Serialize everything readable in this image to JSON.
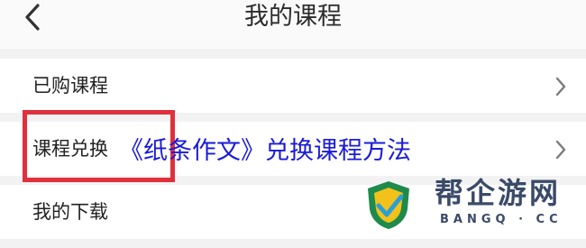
{
  "header": {
    "title": "我的课程",
    "back_icon": "chevron-left-icon"
  },
  "menu": {
    "items": [
      {
        "label": "已购课程",
        "icon": "chevron-right-icon"
      },
      {
        "label": "课程兑换",
        "icon": "chevron-right-icon"
      },
      {
        "label": "我的下载",
        "icon": "chevron-right-icon"
      }
    ]
  },
  "annotation": {
    "caption": "《纸条作文》兑换课程方法",
    "caption_color": "#1a1adb",
    "highlight_color": "#e0303b"
  },
  "watermark": {
    "logo_text": "帮企游网",
    "logo_sub": "BANGQ · CC"
  }
}
